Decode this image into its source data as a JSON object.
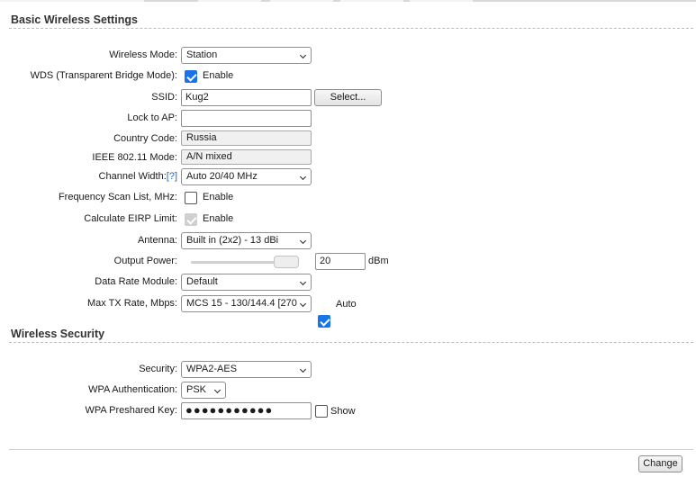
{
  "basic": {
    "title": "Basic Wireless Settings",
    "wireless_mode": {
      "label": "Wireless Mode:",
      "value": "Station"
    },
    "wds": {
      "label": "WDS (Transparent Bridge Mode):",
      "checked": true,
      "option": "Enable"
    },
    "ssid": {
      "label": "SSID:",
      "value": "Kug2",
      "button": "Select..."
    },
    "lock_ap": {
      "label": "Lock to AP:",
      "value": ""
    },
    "country": {
      "label": "Country Code:",
      "value": "Russia"
    },
    "ieee_mode": {
      "label": "IEEE 802.11 Mode:",
      "value": "A/N mixed"
    },
    "channel_width": {
      "label": "Channel Width:",
      "help": "[?]",
      "value": "Auto 20/40 MHz"
    },
    "freq_scan": {
      "label": "Frequency Scan List, MHz:",
      "checked": false,
      "option": "Enable"
    },
    "eirp": {
      "label": "Calculate EIRP Limit:",
      "checked": true,
      "disabled": true,
      "option": "Enable"
    },
    "antenna": {
      "label": "Antenna:",
      "value": "Built in (2x2) - 13 dBi"
    },
    "output_power": {
      "label": "Output Power:",
      "value": "20",
      "unit": "dBm",
      "level": 1.0
    },
    "data_rate": {
      "label": "Data Rate Module:",
      "value": "Default"
    },
    "max_tx": {
      "label": "Max TX Rate, Mbps:",
      "value": "MCS 15 - 130/144.4 [270",
      "auto_checked": true,
      "auto_label": "Auto"
    }
  },
  "security": {
    "title": "Wireless Security",
    "security": {
      "label": "Security:",
      "value": "WPA2-AES"
    },
    "wpa_auth": {
      "label": "WPA Authentication:",
      "value": "PSK"
    },
    "wpa_key": {
      "label": "WPA Preshared Key:",
      "value": "●●●●●●●●●●●",
      "show_checked": false,
      "show_label": "Show"
    }
  },
  "footer": {
    "change_button": "Change"
  },
  "colors": {
    "accent": "#1a73e8",
    "help_link": "#2a63b8"
  }
}
